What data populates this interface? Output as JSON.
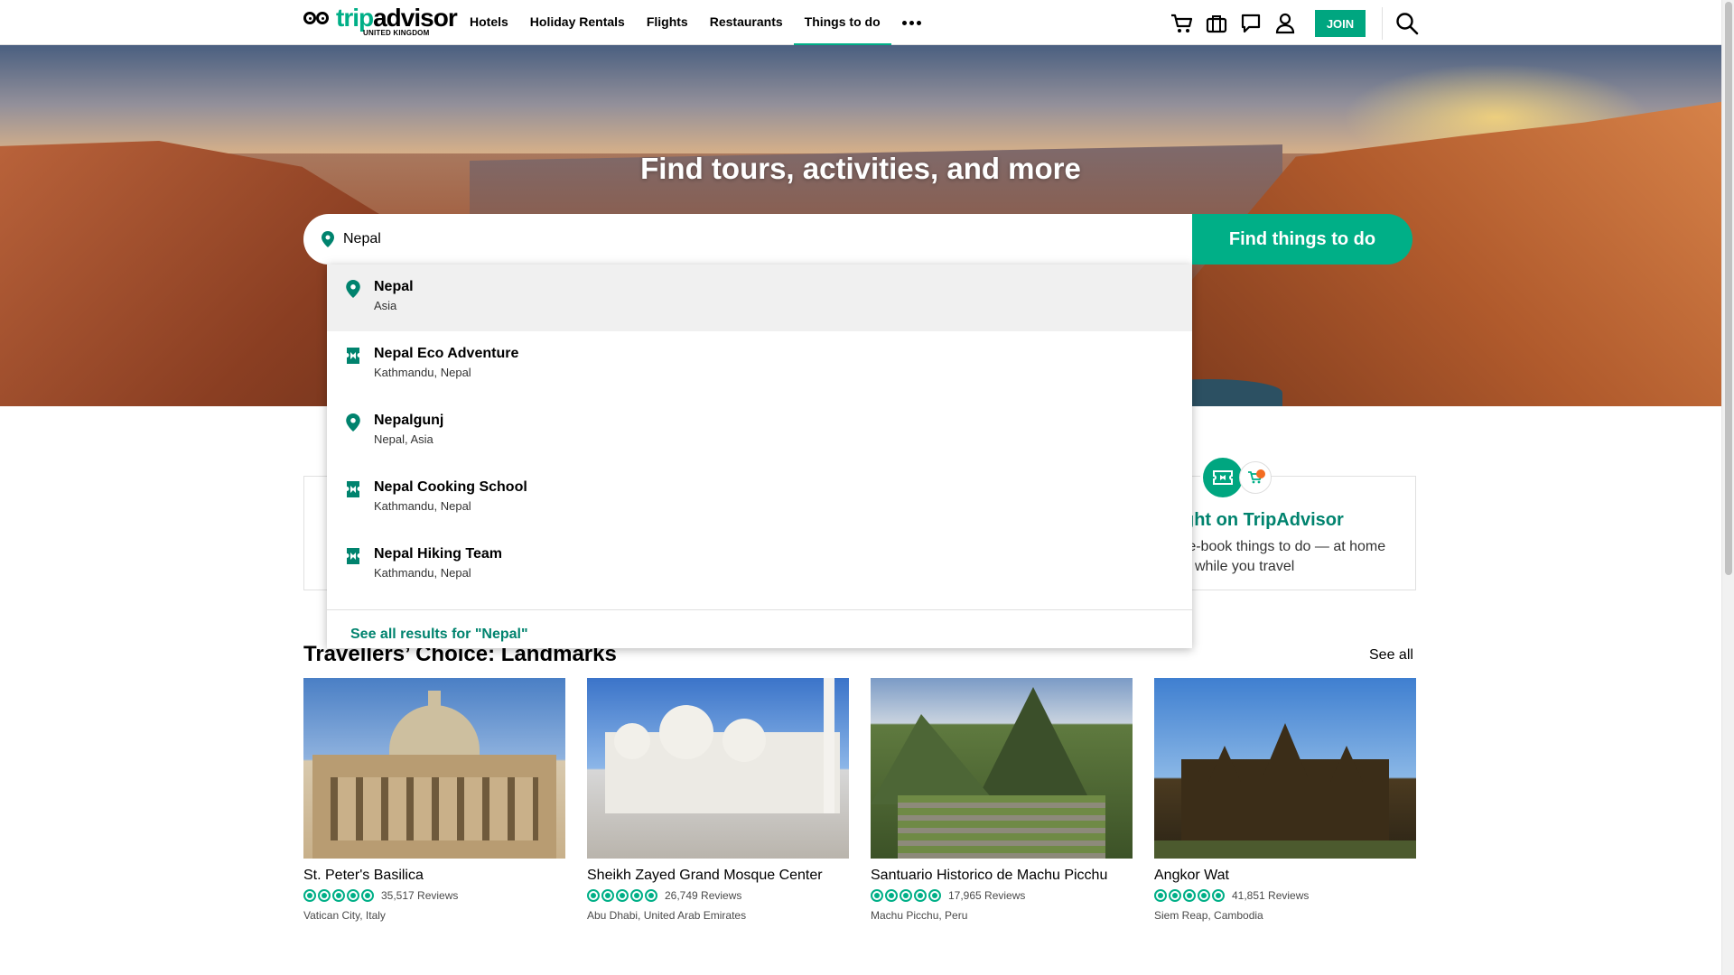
{
  "header": {
    "logo_word": "tripadvisor",
    "logo_sub": "UNITED KINGDOM",
    "nav": [
      {
        "label": "Hotels"
      },
      {
        "label": "Holiday Rentals"
      },
      {
        "label": "Flights"
      },
      {
        "label": "Restaurants"
      },
      {
        "label": "Things to do",
        "active": true
      }
    ],
    "icons": [
      "cart-icon",
      "briefcase-icon",
      "speech-bubble-icon",
      "user-icon"
    ],
    "join_label": "JOIN"
  },
  "hero": {
    "title": "Find tours, activities, and more"
  },
  "search": {
    "value": "Nepal",
    "button_label": "Find things to do"
  },
  "suggestions": {
    "items": [
      {
        "name": "Nepal",
        "sub": "Asia",
        "icon": "location-pin-icon",
        "highlighted": true
      },
      {
        "name": "Nepal Eco Adventure",
        "sub": "Kathmandu, Nepal",
        "icon": "ticket-icon"
      },
      {
        "name": "Nepalgunj",
        "sub": "Nepal, Asia",
        "icon": "location-pin-icon"
      },
      {
        "name": "Nepal Cooking School",
        "sub": "Kathmandu, Nepal",
        "icon": "ticket-icon"
      },
      {
        "name": "Nepal Hiking Team",
        "sub": "Kathmandu, Nepal",
        "icon": "ticket-icon"
      }
    ],
    "see_all": "See all results for \"Nepal\""
  },
  "promo": {
    "title": "ght on TripAdvisor",
    "desc_line1": "re-book things to do — at home",
    "desc_line2": "while you travel"
  },
  "section": {
    "title": "Travellers’ Choice: Landmarks",
    "see_all": "See all",
    "cards": [
      {
        "name": "St. Peter's Basilica",
        "rating": 5,
        "reviews": "35,517 Reviews",
        "location": "Vatican City, Italy"
      },
      {
        "name": "Sheikh Zayed Grand Mosque Center",
        "rating": 5,
        "reviews": "26,749 Reviews",
        "location": "Abu Dhabi, United Arab Emirates"
      },
      {
        "name": "Santuario Historico de Machu Picchu",
        "rating": 5,
        "reviews": "17,965 Reviews",
        "location": "Machu Picchu, Peru"
      },
      {
        "name": "Angkor Wat",
        "rating": 5,
        "reviews": "41,851 Reviews",
        "location": "Siem Reap, Cambodia"
      }
    ]
  },
  "colors": {
    "brand_green": "#00af87",
    "dark_green": "#00836e",
    "notification": "#f36c21"
  }
}
